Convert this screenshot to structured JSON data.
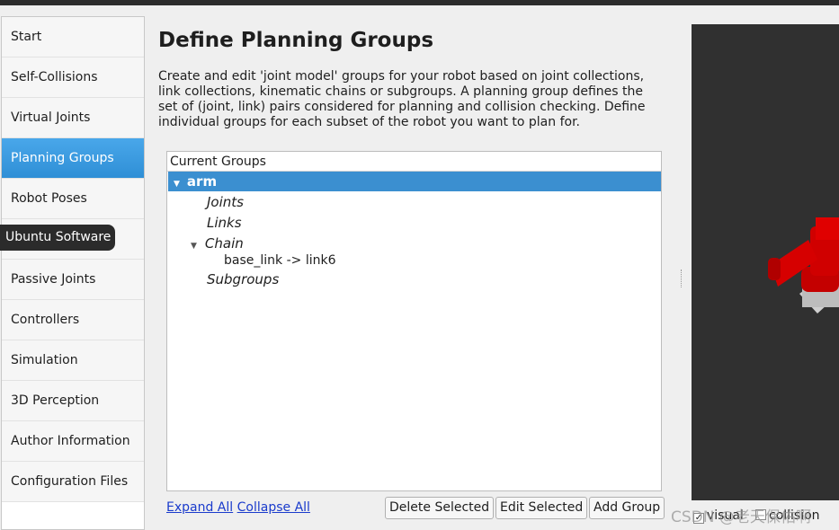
{
  "sidebar": {
    "items": [
      {
        "label": "Start"
      },
      {
        "label": "Self-Collisions"
      },
      {
        "label": "Virtual Joints"
      },
      {
        "label": "Planning Groups",
        "active": true
      },
      {
        "label": "Robot Poses"
      },
      {
        "label": ""
      },
      {
        "label": "Passive Joints"
      },
      {
        "label": "Controllers"
      },
      {
        "label": "Simulation"
      },
      {
        "label": "3D Perception"
      },
      {
        "label": "Author Information"
      },
      {
        "label": "Configuration Files"
      }
    ]
  },
  "tooltip": "Ubuntu Software",
  "main": {
    "title": "Define Planning Groups",
    "description": "Create and edit 'joint model' groups for your robot based on joint collections, link collections, kinematic chains or subgroups. A planning group defines the set of (joint, link) pairs considered for planning and collision checking. Define individual groups for each subset of the robot you want to plan for."
  },
  "tree": {
    "header": "Current Groups",
    "group": "arm",
    "joints": "Joints",
    "links": "Links",
    "chain": "Chain",
    "chain_value": "base_link  ->  link6",
    "subgroups": "Subgroups"
  },
  "actions": {
    "expand_all": "Expand All",
    "collapse_all": "Collapse All",
    "delete": "Delete Selected",
    "edit": "Edit Selected",
    "add": "Add Group"
  },
  "viewer": {
    "visual_label": "visual",
    "visual_checked": true,
    "collision_label": "collision",
    "collision_checked": false,
    "robot_color": "#d40000"
  },
  "watermark": "CSDN @老天保佑啊"
}
